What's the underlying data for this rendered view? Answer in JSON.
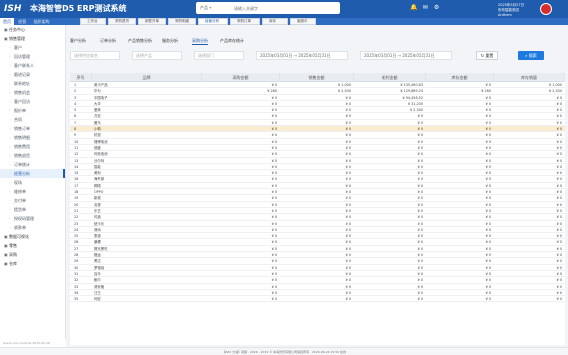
{
  "app": {
    "title": "本海智管D5 ERP测试系统",
    "logo_text": "ISH"
  },
  "topnav": [
    "首页",
    "经营",
    "组织架构"
  ],
  "toptabs": [
    {
      "label": "工作台",
      "active": false
    },
    {
      "label": "采购退货",
      "active": false
    },
    {
      "label": "销售开单",
      "active": false
    },
    {
      "label": "采购明细",
      "active": false
    },
    {
      "label": "经营分析",
      "active": true
    },
    {
      "label": "采购订单",
      "active": false
    },
    {
      "label": "库存",
      "active": false
    },
    {
      "label": "客服中",
      "active": false
    }
  ],
  "search": {
    "category": "产品",
    "placeholder": "请输入关键字"
  },
  "user": {
    "line1": "布布智能测试",
    "line2": "Anthem",
    "date": "2025年5月27日"
  },
  "sidebar": [
    {
      "type": "group",
      "label": "任务中心",
      "icon": "task-icon"
    },
    {
      "type": "group",
      "label": "销售管理",
      "icon": "sales-icon"
    },
    {
      "type": "item",
      "label": "客户",
      "icon": "customer-icon"
    },
    {
      "type": "item",
      "label": "回访管理",
      "icon": "visit-icon"
    },
    {
      "type": "item",
      "label": "客户联系人",
      "icon": "contact-icon"
    },
    {
      "type": "item",
      "label": "跟进记录",
      "icon": "record-icon"
    },
    {
      "type": "item",
      "label": "联系地址",
      "icon": "address-icon"
    },
    {
      "type": "item",
      "label": "销售机会",
      "icon": "opportunity-icon"
    },
    {
      "type": "item",
      "label": "客户回访",
      "icon": "callback-icon"
    },
    {
      "type": "item",
      "label": "报价单",
      "icon": "quote-icon"
    },
    {
      "type": "item",
      "label": "合同",
      "icon": "contract-icon"
    },
    {
      "type": "item",
      "label": "销售订单",
      "icon": "order-icon"
    },
    {
      "type": "item",
      "label": "销售明细",
      "icon": "detail-icon"
    },
    {
      "type": "item",
      "label": "销售费用",
      "icon": "expense-icon"
    },
    {
      "type": "item",
      "label": "销售退货",
      "icon": "return-icon"
    },
    {
      "type": "item",
      "label": "订单统计",
      "icon": "stats-icon"
    },
    {
      "type": "item",
      "label": "经营分析",
      "icon": "chart-icon",
      "active": true
    },
    {
      "type": "item",
      "label": "现场",
      "icon": "field-icon"
    },
    {
      "type": "item",
      "label": "维修单",
      "icon": "repair-icon"
    },
    {
      "type": "item",
      "label": "交付单",
      "icon": "deliver-icon"
    },
    {
      "type": "item",
      "label": "提货单",
      "icon": "pickup-icon"
    },
    {
      "type": "item",
      "label": "授权码管理",
      "icon": "license-icon"
    },
    {
      "type": "item",
      "label": "收款单",
      "icon": "receipt-icon"
    },
    {
      "type": "group",
      "label": "数据可视化",
      "icon": "visual-icon"
    },
    {
      "type": "group",
      "label": "零售",
      "icon": "retail-icon"
    },
    {
      "type": "group",
      "label": "采购",
      "icon": "purchase-icon"
    },
    {
      "type": "group",
      "label": "仓库",
      "icon": "warehouse-icon"
    }
  ],
  "sidebar_footer": "bnerb.com build at 2025-05-28",
  "subtabs": [
    {
      "label": "客户分析",
      "active": false
    },
    {
      "label": "订单分析",
      "active": false
    },
    {
      "label": "产品销售分析",
      "active": false
    },
    {
      "label": "服务分析",
      "active": false
    },
    {
      "label": "采购分析",
      "active": true
    },
    {
      "label": "产品库存统计",
      "active": false
    }
  ],
  "filters": {
    "supplier_placeholder": "选择供应商名",
    "product_placeholder": "选择产品",
    "dept_placeholder": "选择部门",
    "date_range_1": "2025年03月01日  →  2025年05月31日",
    "date_range_2": "2025年03月01日  →  2025年05月31日",
    "reset_label": "重置",
    "search_label": "搜索"
  },
  "table": {
    "headers": [
      "序号",
      "品牌",
      "采购金额",
      "销售金额",
      "毛利金额",
      "库存金额",
      "库存销量"
    ],
    "rows": [
      [
        "1",
        "奥卡产品",
        "¥ 0",
        "¥ 1,000",
        "¥ 135,460.83",
        "¥ 0",
        "¥ 1,000"
      ],
      [
        "2",
        "华为",
        "¥ 280",
        "¥ 2,500",
        "¥ 129,889.24",
        "¥ 280",
        "¥ 2,500"
      ],
      [
        "3",
        "中国电子",
        "¥ 0",
        "¥ 0",
        "¥ 94,458.52",
        "¥ 0",
        "¥ 0"
      ],
      [
        "4",
        "大华",
        "¥ 0",
        "¥ 0",
        "¥ 31,200",
        "¥ 0",
        "¥ 0"
      ],
      [
        "5",
        "爱奇",
        "¥ 0",
        "¥ 0",
        "¥ 2,300",
        "¥ 0",
        "¥ 0"
      ],
      [
        "6",
        "万宏",
        "¥ 0",
        "¥ 0",
        "¥ 0",
        "¥ 0",
        "¥ 0"
      ],
      [
        "7",
        "傲马",
        "¥ 0",
        "¥ 0",
        "¥ 0",
        "¥ 0",
        "¥ 0"
      ],
      [
        "8",
        "小鸭",
        "¥ 0",
        "¥ 0",
        "¥ 0",
        "¥ 0",
        "¥ 0"
      ],
      [
        "9",
        "杭鼠",
        "¥ 0",
        "¥ 0",
        "¥ 0",
        "¥ 0",
        "¥ 0"
      ],
      [
        "10",
        "锂博电池",
        "¥ 0",
        "¥ 0",
        "¥ 0",
        "¥ 0",
        "¥ 0"
      ],
      [
        "11",
        "德盛",
        "¥ 0",
        "¥ 0",
        "¥ 0",
        "¥ 0",
        "¥ 0"
      ],
      [
        "12",
        "利信电池",
        "¥ 0",
        "¥ 0",
        "¥ 0",
        "¥ 0",
        "¥ 0"
      ],
      [
        "13",
        "沃尔玛",
        "¥ 0",
        "¥ 0",
        "¥ 0",
        "¥ 0",
        "¥ 0"
      ],
      [
        "14",
        "智能",
        "¥ 0",
        "¥ 0",
        "¥ 0",
        "¥ 0",
        "¥ 0"
      ],
      [
        "15",
        "美利",
        "¥ 0",
        "¥ 0",
        "¥ 0",
        "¥ 0",
        "¥ 0"
      ],
      [
        "16",
        "海外部",
        "¥ 0",
        "¥ 0",
        "¥ 0",
        "¥ 0",
        "¥ 0"
      ],
      [
        "17",
        "桐硕",
        "¥ 0",
        "¥ 0",
        "¥ 0",
        "¥ 0",
        "¥ 0"
      ],
      [
        "18",
        "OPPO",
        "¥ 0",
        "¥ 0",
        "¥ 0",
        "¥ 0",
        "¥ 0"
      ],
      [
        "19",
        "新奥",
        "¥ 0",
        "¥ 0",
        "¥ 0",
        "¥ 0",
        "¥ 0"
      ],
      [
        "20",
        "克视",
        "¥ 0",
        "¥ 0",
        "¥ 0",
        "¥ 0",
        "¥ 0"
      ],
      [
        "21",
        "乐艺",
        "¥ 0",
        "¥ 0",
        "¥ 0",
        "¥ 0",
        "¥ 0"
      ],
      [
        "22",
        "闪迪",
        "¥ 0",
        "¥ 0",
        "¥ 0",
        "¥ 0",
        "¥ 0"
      ],
      [
        "23",
        "纽卡乐",
        "¥ 0",
        "¥ 0",
        "¥ 0",
        "¥ 0",
        "¥ 0"
      ],
      [
        "24",
        "清尚",
        "¥ 0",
        "¥ 0",
        "¥ 0",
        "¥ 0",
        "¥ 0"
      ],
      [
        "25",
        "泰迪",
        "¥ 0",
        "¥ 0",
        "¥ 0",
        "¥ 0",
        "¥ 0"
      ],
      [
        "26",
        "暴螺",
        "¥ 0",
        "¥ 0",
        "¥ 0",
        "¥ 0",
        "¥ 0"
      ],
      [
        "27",
        "擦光黑吃",
        "¥ 0",
        "¥ 0",
        "¥ 0",
        "¥ 0",
        "¥ 0"
      ],
      [
        "28",
        "猎运",
        "¥ 0",
        "¥ 0",
        "¥ 0",
        "¥ 0",
        "¥ 0"
      ],
      [
        "29",
        "黑达",
        "¥ 0",
        "¥ 0",
        "¥ 0",
        "¥ 0",
        "¥ 0"
      ],
      [
        "30",
        "罗德纯",
        "¥ 0",
        "¥ 0",
        "¥ 0",
        "¥ 0",
        "¥ 0"
      ],
      [
        "31",
        "百乐",
        "¥ 0",
        "¥ 0",
        "¥ 0",
        "¥ 0",
        "¥ 0"
      ],
      [
        "32",
        "鲍尔",
        "¥ 0",
        "¥ 0",
        "¥ 0",
        "¥ 0",
        "¥ 0"
      ],
      [
        "33",
        "清安格",
        "¥ 0",
        "¥ 0",
        "¥ 0",
        "¥ 0",
        "¥ 0"
      ],
      [
        "34",
        "汪王",
        "¥ 0",
        "¥ 0",
        "¥ 0",
        "¥ 0",
        "¥ 0"
      ],
      [
        "35",
        "利宏",
        "¥ 0",
        "¥ 0",
        "¥ 0",
        "¥ 0",
        "¥ 0"
      ]
    ],
    "highlight_row": 7
  },
  "statusbar": "【ZZX 大诚】就绪 · 2026 - 2032 © 本海智管有限公司版权所有 · 2026-06-24 23:56 在线"
}
